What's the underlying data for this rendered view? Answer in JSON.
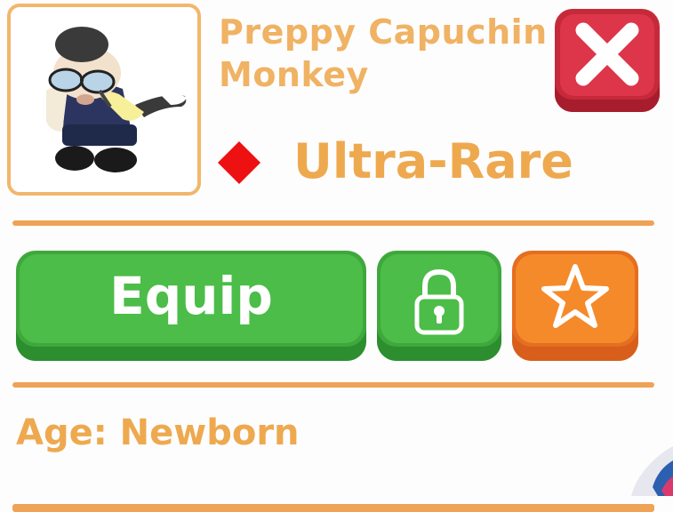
{
  "pet": {
    "name": "Preppy Capuchin Monkey",
    "rarity": "Ultra-Rare",
    "age_text": "Age: Newborn",
    "image_icon": "capuchin-monkey-pet-icon"
  },
  "buttons": {
    "close_icon": "close-x-icon",
    "equip_label": "Equip",
    "lock_icon": "padlock-icon",
    "favorite_icon": "star-icon"
  },
  "colors": {
    "accent_text": "#f0b263",
    "divider": "#efa356",
    "rarity_diamond": "#ee1111",
    "close_button": "#dd3549",
    "equip_button": "#4cbd48",
    "favorite_button": "#f58a2a"
  }
}
